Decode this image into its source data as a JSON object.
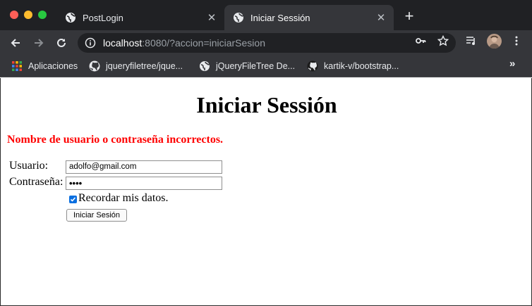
{
  "tabs": [
    {
      "title": "PostLogin",
      "active": false
    },
    {
      "title": "Iniciar Sessión",
      "active": true
    }
  ],
  "toolbar": {
    "url_host": "localhost",
    "url_rest": ":8080/?accion=iniciarSesion"
  },
  "bookmarks": {
    "items": [
      {
        "label": "Aplicaciones",
        "icon": "apps-grid-icon"
      },
      {
        "label": "jqueryfiletree/jque...",
        "icon": "github-icon"
      },
      {
        "label": "jQueryFileTree De...",
        "icon": "globe-icon"
      },
      {
        "label": "kartik-v/bootstrap...",
        "icon": "github-icon"
      }
    ],
    "more": "»"
  },
  "page": {
    "title": "Iniciar Sessión",
    "error": "Nombre de usuario o contraseña incorrectos.",
    "username_label": "Usuario:",
    "username_value": "adolfo@gmail.com",
    "password_label": "Contraseña:",
    "password_mask": "••••",
    "remember_label": "Recordar mis datos.",
    "remember_checked": true,
    "submit_label": "Iniciar Sesión"
  },
  "colors": {
    "chrome_dark": "#202124",
    "chrome_toolbar": "#35363a",
    "error_red": "#ff0000",
    "checkbox_blue": "#0a6fe0"
  }
}
